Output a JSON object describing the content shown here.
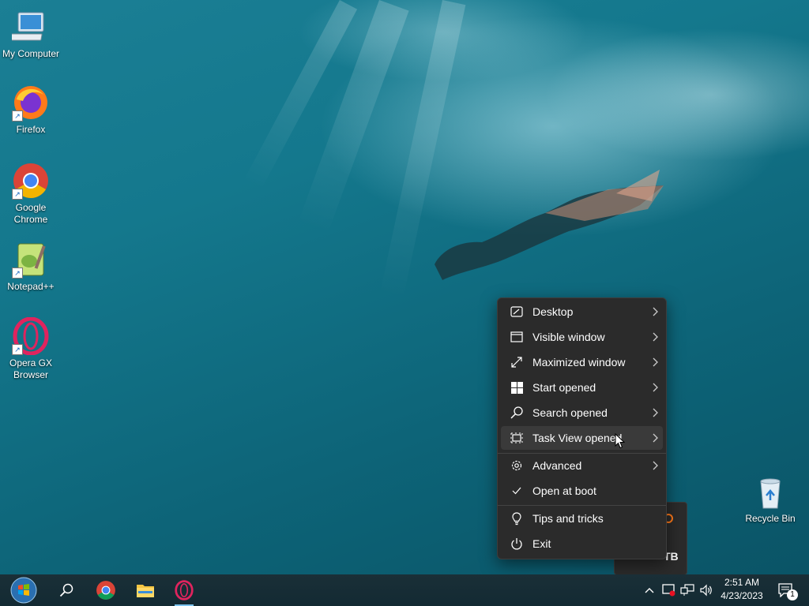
{
  "desktop": {
    "icons": [
      {
        "label": "My Computer",
        "icon": "computer-icon"
      },
      {
        "label": "Firefox",
        "icon": "firefox-icon"
      },
      {
        "label": "Google Chrome",
        "icon": "chrome-icon"
      },
      {
        "label": "Notepad++",
        "icon": "notepadpp-icon"
      },
      {
        "label": "Opera GX Browser",
        "icon": "opera-gx-icon"
      }
    ],
    "recycle_bin": {
      "label": "Recycle Bin",
      "icon": "recycle-bin-icon"
    }
  },
  "context_menu": {
    "items": [
      {
        "label": "Desktop",
        "icon": "desktop-icon",
        "submenu": true
      },
      {
        "label": "Visible window",
        "icon": "window-icon",
        "submenu": true
      },
      {
        "label": "Maximized window",
        "icon": "maximize-icon",
        "submenu": true
      },
      {
        "label": "Start opened",
        "icon": "windows-logo-icon",
        "submenu": true
      },
      {
        "label": "Search opened",
        "icon": "search-icon",
        "submenu": true
      },
      {
        "label": "Task View opened",
        "icon": "task-view-icon",
        "submenu": true,
        "hovered": true
      },
      {
        "label": "Advanced",
        "icon": "gear-icon",
        "submenu": true
      },
      {
        "label": "Open at boot",
        "icon": "checkmark-icon",
        "checked": true
      },
      {
        "label": "Tips and tricks",
        "icon": "lightbulb-icon"
      },
      {
        "label": "Exit",
        "icon": "power-icon"
      }
    ]
  },
  "taskbar": {
    "pinned": [
      "start-button",
      "search-button",
      "chrome-taskbar-icon",
      "file-explorer-taskbar-icon",
      "opera-gx-taskbar-icon"
    ],
    "clock": {
      "time": "2:51 AM",
      "date": "4/23/2023"
    },
    "notification_count": "1",
    "colors": {
      "accent": "#7cc4f0",
      "taskbar_bg": "#15303a"
    }
  }
}
